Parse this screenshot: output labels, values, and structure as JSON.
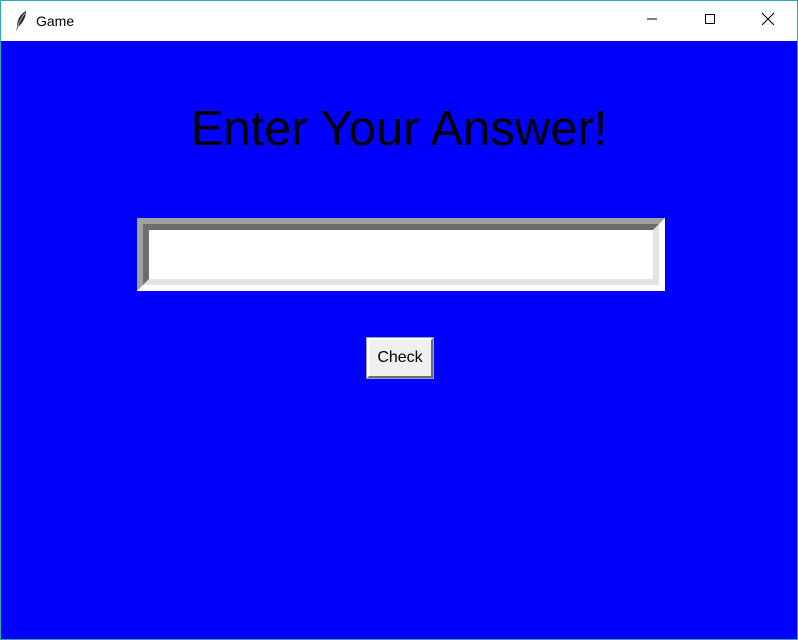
{
  "window": {
    "title": "Game",
    "icon": "feather-icon",
    "controls": {
      "minimize_icon": "minimize-icon",
      "maximize_icon": "maximize-icon",
      "close_icon": "close-icon"
    }
  },
  "main": {
    "heading": "Enter Your Answer!",
    "answer_input": {
      "value": "",
      "placeholder": ""
    },
    "check_button_label": "Check"
  },
  "colors": {
    "background": "#0000ff",
    "heading_text": "#000000",
    "titlebar": "#ffffff",
    "button_face": "#f0f0f0"
  }
}
